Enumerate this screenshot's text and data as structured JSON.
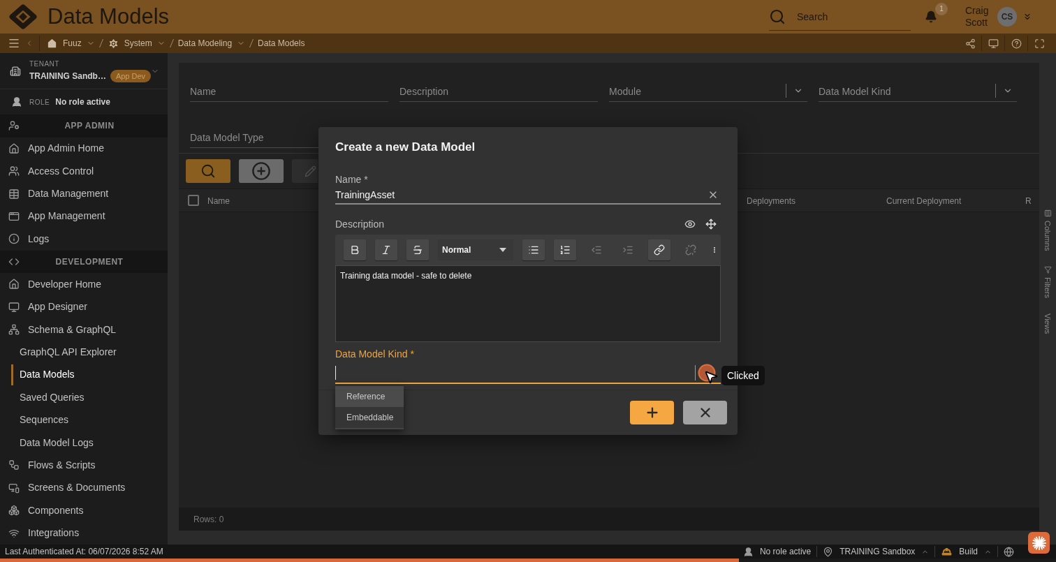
{
  "header": {
    "title": "Data Models",
    "search": {
      "placeholder": "Search"
    },
    "notification_count": "1",
    "user": {
      "name": "Craig Scott",
      "initials": "CS"
    }
  },
  "breadcrumbs": [
    {
      "label": "Fuuz",
      "dropdown": true
    },
    {
      "label": "System",
      "dropdown": true
    },
    {
      "label": "Data Modeling",
      "dropdown": true
    },
    {
      "label": "Data Models",
      "dropdown": false
    }
  ],
  "sidebar": {
    "tenant": {
      "label": "TENANT",
      "name": "TRAINING Sandb…",
      "badge": "App Dev"
    },
    "role": {
      "label": "ROLE",
      "value": "No role active"
    },
    "sections": [
      {
        "title": "APP ADMIN",
        "items": [
          {
            "label": "App Admin Home",
            "selected": false
          },
          {
            "label": "Access Control",
            "selected": false
          },
          {
            "label": "Data Management",
            "selected": false
          },
          {
            "label": "App Management",
            "selected": false
          },
          {
            "label": "Logs",
            "selected": false
          }
        ]
      },
      {
        "title": "DEVELOPMENT",
        "items": [
          {
            "label": "Developer Home",
            "selected": false
          },
          {
            "label": "App Designer",
            "selected": false
          },
          {
            "label": "Schema & GraphQL",
            "selected": false,
            "children": [
              {
                "label": "GraphQL API Explorer",
                "selected": false
              },
              {
                "label": "Data Models",
                "selected": true
              },
              {
                "label": "Saved Queries",
                "selected": false
              },
              {
                "label": "Sequences",
                "selected": false
              },
              {
                "label": "Data Model Logs",
                "selected": false
              }
            ]
          },
          {
            "label": "Flows & Scripts",
            "selected": false
          },
          {
            "label": "Screens & Documents",
            "selected": false
          },
          {
            "label": "Components",
            "selected": false
          },
          {
            "label": "Integrations",
            "selected": false
          }
        ]
      }
    ]
  },
  "filters": [
    {
      "placeholder": "Name",
      "kind": "text"
    },
    {
      "placeholder": "Description",
      "kind": "text"
    },
    {
      "placeholder": "Module",
      "kind": "select"
    },
    {
      "placeholder": "Data Model Kind",
      "kind": "select"
    },
    {
      "placeholder": "Data Model Type",
      "kind": "text"
    }
  ],
  "toolbar": [
    {
      "kind": "search",
      "disabled": false
    },
    {
      "kind": "add",
      "disabled": false
    },
    {
      "kind": "edit",
      "disabled": true
    }
  ],
  "table": {
    "select_all": {
      "checked": false
    },
    "columns": [
      "Name",
      "Deployments",
      "Current Deployment",
      "R"
    ],
    "footer": "Rows: 0"
  },
  "side_panel": [
    "Columns",
    "Filters",
    "Views"
  ],
  "dialog": {
    "title": "Create a new Data Model",
    "name_field": {
      "label": "Name *",
      "value": "TrainingAsset"
    },
    "description_field": {
      "label": "Description",
      "toolbar": [
        {
          "kind": "bold",
          "disabled": false
        },
        {
          "kind": "italic",
          "disabled": false
        },
        {
          "kind": "strike",
          "disabled": false
        },
        {
          "kind": "format",
          "value": "Normal",
          "disabled": false
        },
        {
          "kind": "bullet_list",
          "disabled": false
        },
        {
          "kind": "ordered_list",
          "disabled": false
        },
        {
          "kind": "outdent",
          "disabled": true
        },
        {
          "kind": "indent",
          "disabled": true
        },
        {
          "kind": "link",
          "disabled": false
        },
        {
          "kind": "unlink",
          "disabled": true
        },
        {
          "kind": "more",
          "disabled": false
        }
      ],
      "value": "Training data model - safe to delete"
    },
    "kind_field": {
      "label": "Data Model Kind *",
      "focused": true,
      "options": [
        {
          "label": "Reference",
          "highlighted": true
        },
        {
          "label": "Embeddable",
          "highlighted": false
        }
      ]
    },
    "actions": [
      {
        "kind": "create"
      },
      {
        "kind": "cancel"
      }
    ]
  },
  "click_marker": {
    "tooltip": "Clicked"
  },
  "status_bar": {
    "last_authenticated": "Last Authenticated At: 06/07/2026 8:52 AM",
    "items": [
      {
        "kind": "role",
        "label": "No role active",
        "menu": false
      },
      {
        "kind": "site",
        "label": "TRAINING Sandbox",
        "menu": true
      },
      {
        "kind": "environment",
        "label": "Build",
        "menu": true
      }
    ]
  },
  "progress": {
    "level": 0.7
  }
}
